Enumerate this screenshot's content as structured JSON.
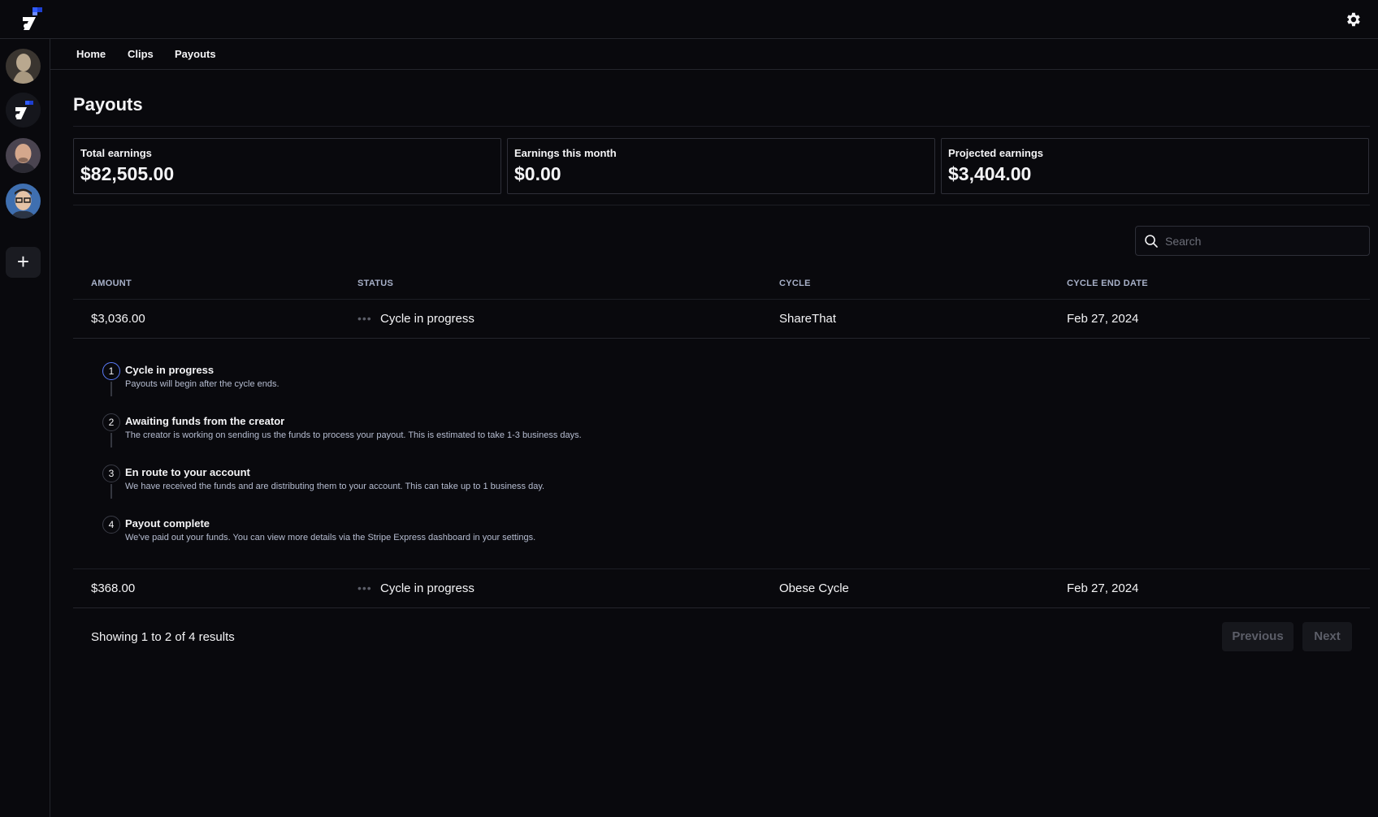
{
  "nav": {
    "home": "Home",
    "clips": "Clips",
    "payouts": "Payouts"
  },
  "icons": {
    "logo": "app-logo-icon",
    "settings": "gear-icon",
    "add": "plus-icon",
    "search": "search-icon"
  },
  "sidebar": {
    "add_label": "+"
  },
  "page": {
    "title": "Payouts"
  },
  "stats": [
    {
      "label": "Total earnings",
      "value": "$82,505.00"
    },
    {
      "label": "Earnings this month",
      "value": "$0.00"
    },
    {
      "label": "Projected earnings",
      "value": "$3,404.00"
    }
  ],
  "search": {
    "placeholder": "Search",
    "value": ""
  },
  "table": {
    "headers": [
      "AMOUNT",
      "STATUS",
      "CYCLE",
      "CYCLE END DATE"
    ],
    "rows": [
      {
        "amount": "$3,036.00",
        "dots": "•••",
        "status": "Cycle in progress",
        "cycle": "ShareThat",
        "end_date": "Feb 27, 2024"
      },
      {
        "amount": "$368.00",
        "dots": "•••",
        "status": "Cycle in progress",
        "cycle": "Obese Cycle",
        "end_date": "Feb 27, 2024"
      }
    ]
  },
  "steps": [
    {
      "num": "1",
      "title": "Cycle in progress",
      "desc": "Payouts will begin after the cycle ends."
    },
    {
      "num": "2",
      "title": "Awaiting funds from the creator",
      "desc": "The creator is working on sending us the funds to process your payout. This is estimated to take 1-3 business days."
    },
    {
      "num": "3",
      "title": "En route to your account",
      "desc": "We have received the funds and are distributing them to your account. This can take up to 1 business day."
    },
    {
      "num": "4",
      "title": "Payout complete",
      "desc": "We've paid out your funds. You can view more details via the Stripe Express dashboard in your settings."
    }
  ],
  "pagination": {
    "summary": "Showing 1 to 2 of 4 results",
    "previous": "Previous",
    "next": "Next"
  },
  "colors": {
    "background": "#09090d",
    "border": "#24252c",
    "accent": "#5b7cfa",
    "logo_blue": "#2f5bff"
  }
}
